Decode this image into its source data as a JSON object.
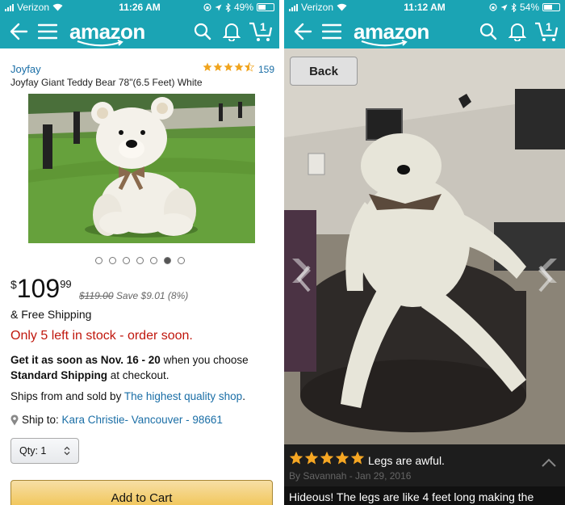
{
  "left": {
    "status": {
      "carrier": "Verizon",
      "time": "11:26 AM",
      "battery": "49%",
      "battery_level": 0.49
    },
    "nav": {
      "logo": "amazon",
      "cart_count": "1"
    },
    "product": {
      "brand": "Joyfay",
      "rating": 4.5,
      "review_count": "159",
      "title": "Joyfay Giant Teddy Bear 78\"(6.5 Feet) White",
      "image_count": 7,
      "image_active_index": 5,
      "price_currency": "$",
      "price_dollars": "109",
      "price_cents": "99",
      "list_price": "$119.00",
      "savings": "Save $9.01 (8%)",
      "shipping": "& Free Shipping",
      "stock_notice": "Only 5 left in stock - order soon.",
      "delivery_prefix": "Get it as soon as Nov. 16 - 20",
      "delivery_mid": " when you choose ",
      "delivery_method": "Standard Shipping",
      "delivery_suffix": " at checkout.",
      "sold_by_prefix": "Ships from and sold by ",
      "sold_by_seller": "The highest quality shop",
      "sold_by_suffix": ".",
      "ship_to_label": "Ship to: ",
      "ship_to_address": "Kara Christie- Vancouver - 98661",
      "qty_label": "Qty:",
      "qty_value": "1",
      "add_to_cart": "Add to Cart"
    },
    "colors": {
      "nav_bg": "#1ba4b4",
      "link": "#1a6ea6",
      "stock_red": "#c0170d",
      "button": "#f0c14b"
    }
  },
  "right": {
    "status": {
      "carrier": "Verizon",
      "time": "11:12 AM",
      "battery": "54%",
      "battery_level": 0.54
    },
    "nav": {
      "logo": "amazon",
      "cart_count": "1"
    },
    "back_label": "Back",
    "review": {
      "rating": 5,
      "title": "Legs are awful.",
      "byline": "By Savannah - Jan 29, 2016",
      "text": "Hideous! The legs are like 4 feet long making the"
    }
  }
}
